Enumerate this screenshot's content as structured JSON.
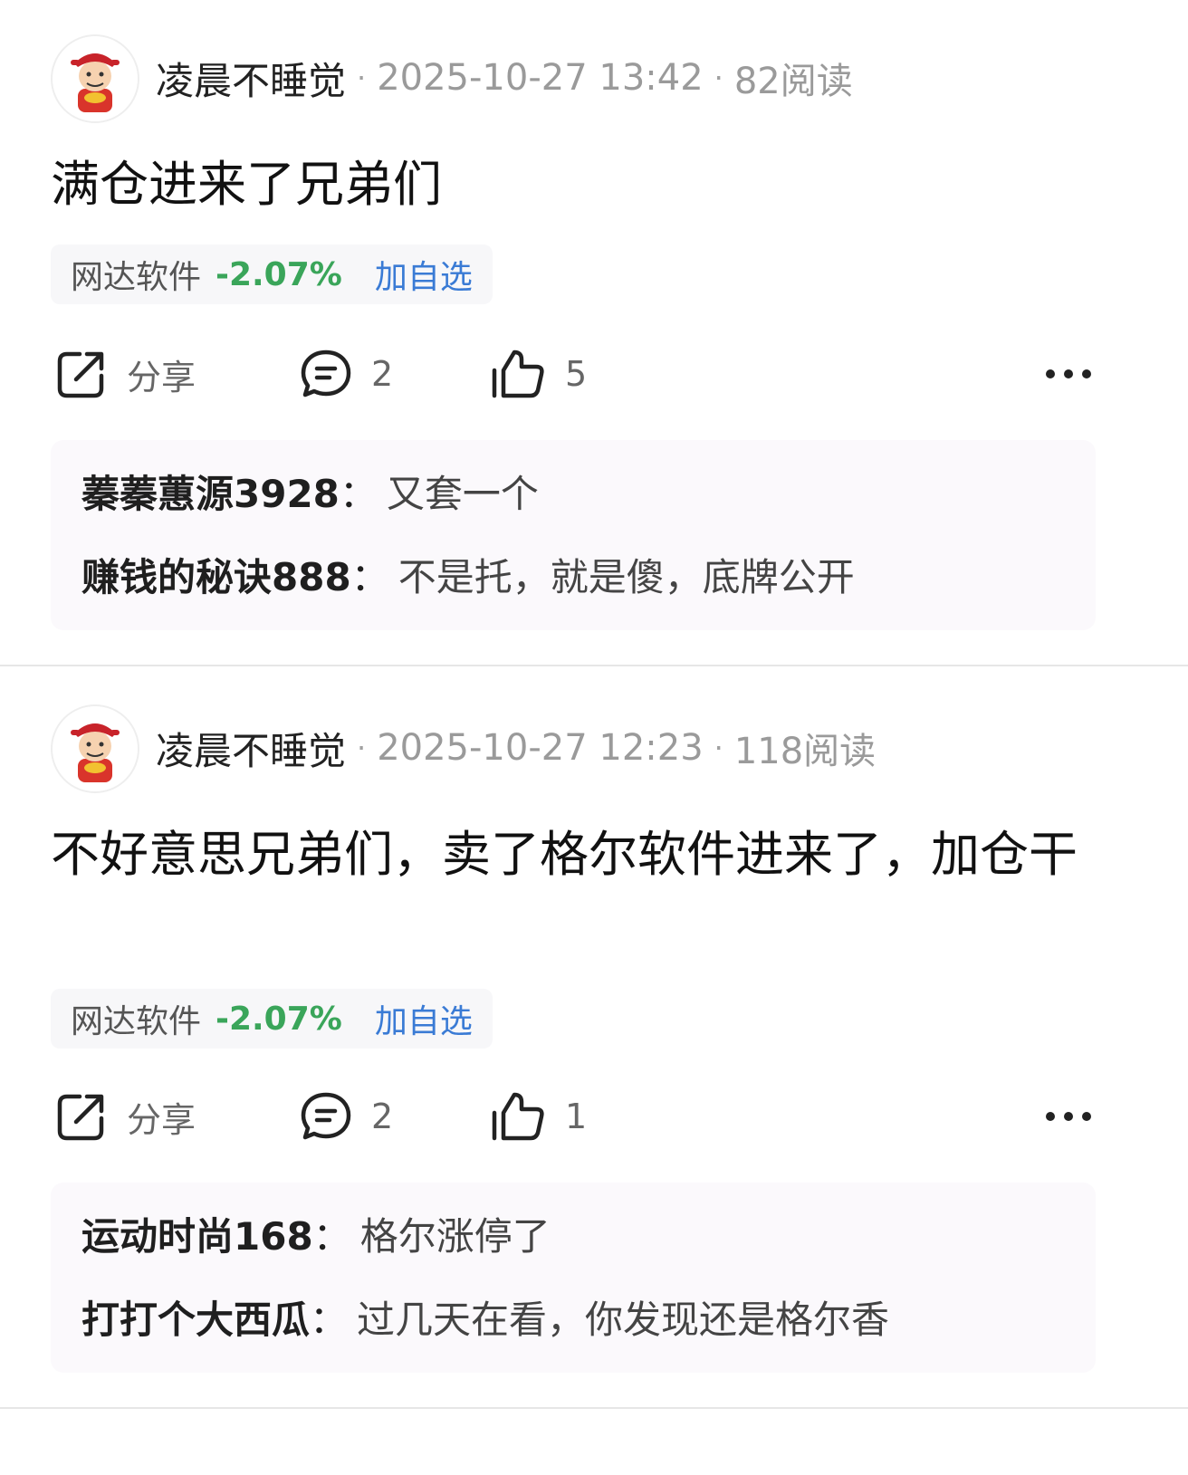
{
  "posts": [
    {
      "author": "凌晨不睡觉",
      "time": "2025-10-27 13:42",
      "reads": "82阅读",
      "separator": "·",
      "content": "满仓进来了兄弟们",
      "stock": {
        "name": "网达软件",
        "change": "-2.07%",
        "add": "加自选"
      },
      "actions": {
        "share": "分享",
        "comments": "2",
        "likes": "5"
      },
      "comments": [
        {
          "user": "蓁蓁蕙源3928",
          "colon": "：",
          "text": "又套一个"
        },
        {
          "user": "赚钱的秘诀888",
          "colon": "：",
          "text": "不是托，就是傻，底牌公开"
        }
      ]
    },
    {
      "author": "凌晨不睡觉",
      "time": "2025-10-27 12:23",
      "reads": "118阅读",
      "separator": "·",
      "content": "不好意思兄弟们，卖了格尔软件进来了，加仓干",
      "stock": {
        "name": "网达软件",
        "change": "-2.07%",
        "add": "加自选"
      },
      "actions": {
        "share": "分享",
        "comments": "2",
        "likes": "1"
      },
      "comments": [
        {
          "user": "运动时尚168",
          "colon": "：",
          "text": "格尔涨停了"
        },
        {
          "user": "打打个大西瓜",
          "colon": "：",
          "text": "过几天在看，你发现还是格尔香"
        }
      ]
    }
  ],
  "colors": {
    "negative_change": "#3aa55a",
    "link": "#3a7bd5",
    "meta_gray": "#9a9a9a"
  },
  "icons": {
    "share": "share-icon",
    "comment": "comment-icon",
    "like": "thumbs-up-icon",
    "more": "more-icon",
    "avatar": "caishen-avatar"
  }
}
